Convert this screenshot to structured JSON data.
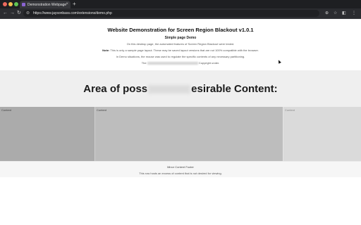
{
  "browser": {
    "tab_title": "Demonstration Webpage",
    "tab_close": "×",
    "new_tab": "+",
    "url": "https://www.jaysonbass.com/extensions/demo.php",
    "icons": [
      "back-arrow",
      "forward-arrow",
      "reload",
      "zoom",
      "star",
      "extension",
      "menu"
    ]
  },
  "header": {
    "title": "Website Demonstration for Screen Region Blackout v1.0.1",
    "subtitle": "Simple page Demo",
    "desc_line1": "On this desktop page, the automated features of Screen Region Blackout were tested.",
    "note_label": "Note:",
    "desc_line2": "This is only a sample page layout. These may be saved layout versions that are not 100% compatible with the browser.",
    "desc_line3": "In Demo situations, the mouse was used to regulate the specific contents of any necessary partitioning.",
    "desc_line4_prefix": "The",
    "desc_line4_suffix": "Copyright under."
  },
  "content": {
    "heading_prefix": "Area of poss",
    "heading_suffix": "esirable Content:"
  },
  "columns": [
    {
      "label": "Content"
    },
    {
      "label": "Content"
    },
    {
      "label": "Content"
    }
  ],
  "footer": {
    "title": "Minor Content Footer",
    "text": "This row hosts an excess of content that is not desired for viewing."
  }
}
